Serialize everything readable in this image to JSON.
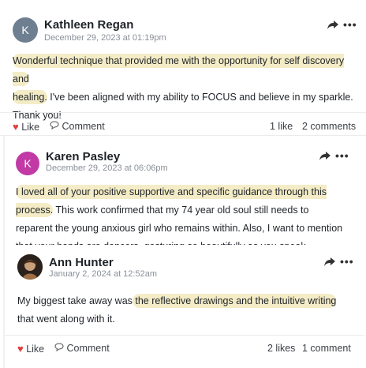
{
  "post": {
    "author": "Kathleen Regan",
    "avatar_initial": "K",
    "date": "December 29, 2023 at 01:19pm",
    "text_hl1": "Wonderful technique that  provided me with the opportunity for self discovery and",
    "text_hl2": "healing.",
    "text_rest": " I've been aligned with my ability to FOCUS and believe in my sparkle. Thank you!",
    "like_label": "Like",
    "comment_label": "Comment",
    "likes_count": "1 like",
    "comments_count": "2 comments"
  },
  "reply1": {
    "author": "Karen Pasley",
    "avatar_initial": "K",
    "date": "December 29, 2023 at 06:06pm",
    "text_hl": "I loved all of your positive supportive and specific guidance through this process.",
    "text_rest": " This work confirmed that my 74 year old soul still needs to reparent the young anxious girl who remains within. Also, I want to mention that your hands are dancers, gesturing so beautifully as you speak."
  },
  "reply2": {
    "author": "Ann Hunter",
    "date": "January 2, 2024 at 12:52am",
    "text_pre": "My biggest take away was",
    "text_hl": " the reflective drawings and the intuitive writing",
    "text_post": " that went along with it.",
    "like_label": "Like",
    "comment_label": "Comment",
    "likes_count": "2 likes",
    "comments_count": "1 comment"
  },
  "colors": {
    "highlight": "#f4ecc6",
    "kathleen_avatar": "#6e7f91",
    "karen_avatar": "#c23aa5",
    "like": "#e03e3e"
  },
  "icons": [
    "share-arrow-icon",
    "more-dots-icon",
    "heart-icon",
    "comment-bubble-icon"
  ]
}
